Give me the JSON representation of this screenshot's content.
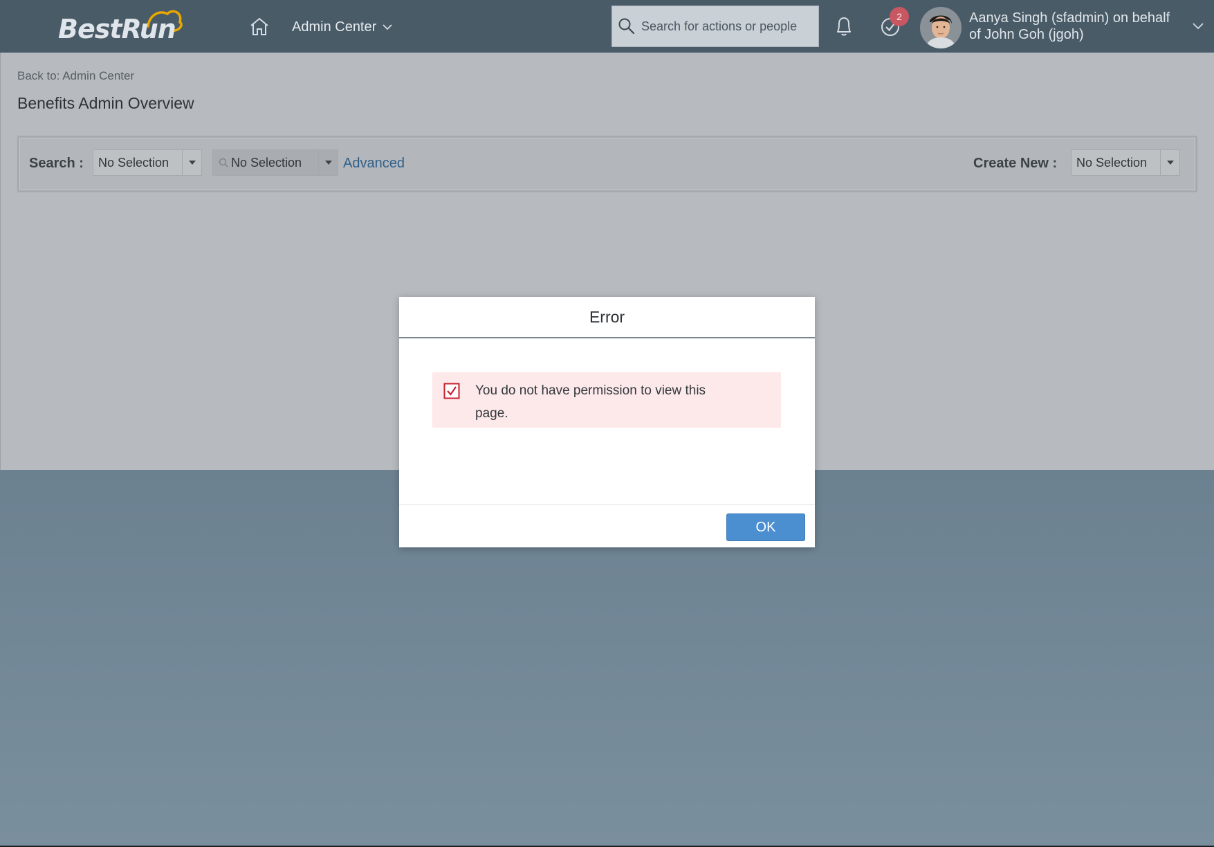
{
  "shell": {
    "logo_text": "BestRun",
    "admin_menu_label": "Admin Center",
    "search_placeholder": "Search for actions or people",
    "todo_count": "2",
    "user_name_line1": "Aanya Singh (sfadmin) on behalf",
    "user_name_line2": "of John Goh (jgoh)"
  },
  "page": {
    "back_link": "Back to: Admin Center",
    "title": "Benefits Admin Overview"
  },
  "toolbar": {
    "search_label": "Search :",
    "search_select_value": "No Selection",
    "search_select2_value": "No Selection",
    "advanced_label": "Advanced",
    "create_new_label": "Create New :",
    "create_new_value": "No Selection"
  },
  "dialog": {
    "title": "Error",
    "message": "You do not have permission to view this page.",
    "ok_label": "OK"
  },
  "colors": {
    "shell_bg": "#4a5b68",
    "primary_button": "#4c8fd1",
    "error_bg": "#fde8ea",
    "error_icon": "#c8202e",
    "badge": "#c75761",
    "link": "#2f5e88"
  }
}
